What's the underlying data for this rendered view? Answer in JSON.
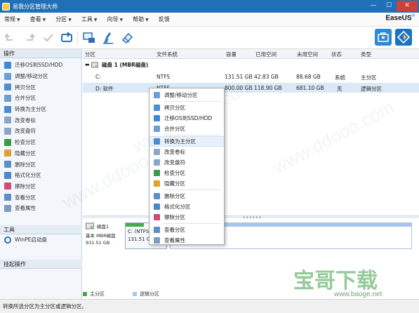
{
  "window": {
    "title": "易我分区管理大师",
    "minimize": "—",
    "maximize": "☐",
    "close": "✕"
  },
  "menu": [
    "常规",
    "查看",
    "分区",
    "工具",
    "向导",
    "帮助",
    "反馈"
  ],
  "brand": {
    "name": "EaseUS",
    "mark": "®"
  },
  "left_panel": {
    "operations_header": "操作",
    "operations": [
      {
        "label": "迁移OS到SSD/HDD",
        "icon": "migrate-os-icon",
        "color": "#3b8bd6"
      },
      {
        "label": "调整/移动分区",
        "icon": "resize-partition-icon",
        "color": "#6aa0d8"
      },
      {
        "label": "拷贝分区",
        "icon": "copy-partition-icon",
        "color": "#4f8fd0"
      },
      {
        "label": "合并分区",
        "icon": "merge-partition-icon",
        "color": "#6c9fd4"
      },
      {
        "label": "转换为主分区",
        "icon": "convert-primary-icon",
        "color": "#4b8bd0"
      },
      {
        "label": "改变卷标",
        "icon": "change-label-icon",
        "color": "#8aa7c8"
      },
      {
        "label": "改变盘符",
        "icon": "change-letter-icon",
        "color": "#8aa7c8"
      },
      {
        "label": "检查分区",
        "icon": "check-partition-icon",
        "color": "#3a9a4a"
      },
      {
        "label": "隐藏分区",
        "icon": "hide-partition-icon",
        "color": "#e0a030"
      },
      {
        "label": "删除分区",
        "icon": "delete-partition-icon",
        "color": "#5b8fc8"
      },
      {
        "label": "格式化分区",
        "icon": "format-partition-icon",
        "color": "#4a88c8"
      },
      {
        "label": "擦除分区",
        "icon": "wipe-partition-icon",
        "color": "#d04a7a"
      },
      {
        "label": "查看分区",
        "icon": "view-partition-icon",
        "color": "#5d8fc4"
      },
      {
        "label": "查看属性",
        "icon": "properties-icon",
        "color": "#7e9cbf"
      }
    ],
    "tools_header": "工具",
    "tools": [
      {
        "label": "WinPE启动盘",
        "icon": "winpe-disc-icon"
      }
    ],
    "pending_header": "挂起操作"
  },
  "table": {
    "columns": [
      "分区",
      "文件系统",
      "容量",
      "已用空间",
      "未用空间",
      "状态",
      "类型"
    ],
    "disk_label": "磁盘 1 (MBR磁盘)",
    "rows": [
      {
        "partition": "C:",
        "fs": "NTFS",
        "capacity": "131.51 GB",
        "used": "42.83 GB",
        "free": "88.68 GB",
        "status": "系统",
        "type": "主分区",
        "selected": false
      },
      {
        "partition": "D: 软件",
        "fs": "NTFS",
        "capacity": "800.00 GB",
        "used": "118.90 GB",
        "free": "681.10 GB",
        "status": "无",
        "type": "逻辑分区",
        "selected": true
      }
    ]
  },
  "disk_map": {
    "disk_name": "磁盘1",
    "disk_type": "基本 MBR磁盘",
    "disk_size": "931.51 GB",
    "c_label": "C: (NTFS",
    "c_size": "131.51 GB"
  },
  "legend": [
    {
      "label": "主分区",
      "color": "#3fae49"
    },
    {
      "label": "逻辑分区",
      "color": "#a6c8ec"
    }
  ],
  "context_menu": [
    {
      "label": "调整/移动分区",
      "icon": "resize-partition-icon",
      "color": "#6aa0d8",
      "sep_before": false
    },
    {
      "label": "拷贝分区",
      "icon": "copy-partition-icon",
      "color": "#4f8fd0",
      "sep_before": true
    },
    {
      "label": "迁移OS到SSD/HDD",
      "icon": "migrate-os-icon",
      "color": "#3b8bd6",
      "sep_before": false
    },
    {
      "label": "合并分区",
      "icon": "merge-partition-icon",
      "color": "#6c9fd4",
      "sep_before": false
    },
    {
      "label": "转换为主分区",
      "icon": "convert-primary-icon",
      "color": "#4b8bd0",
      "sep_before": true,
      "highlight": true
    },
    {
      "label": "改变卷标",
      "icon": "change-label-icon",
      "color": "#8aa7c8",
      "sep_before": false
    },
    {
      "label": "改变盘符",
      "icon": "change-letter-icon",
      "color": "#8aa7c8",
      "sep_before": false
    },
    {
      "label": "检查分区",
      "icon": "check-partition-icon",
      "color": "#3a9a4a",
      "sep_before": false
    },
    {
      "label": "隐藏分区",
      "icon": "hide-partition-icon",
      "color": "#e0a030",
      "sep_before": false
    },
    {
      "label": "删除分区",
      "icon": "delete-partition-icon",
      "color": "#5b8fc8",
      "sep_before": true
    },
    {
      "label": "格式化分区",
      "icon": "format-partition-icon",
      "color": "#4a88c8",
      "sep_before": false
    },
    {
      "label": "擦除分区",
      "icon": "wipe-partition-icon",
      "color": "#d04a7a",
      "sep_before": false
    },
    {
      "label": "查看分区",
      "icon": "view-partition-icon",
      "color": "#5d8fc4",
      "sep_before": true
    },
    {
      "label": "查看属性",
      "icon": "properties-icon",
      "color": "#7e9cbf",
      "sep_before": false
    }
  ],
  "status_bar": "转换所选分区为主分区或逻辑分区。",
  "watermark": {
    "site": "www.ddooo.com",
    "logo": "宝哥下载",
    "url": "www.baoge.net"
  }
}
